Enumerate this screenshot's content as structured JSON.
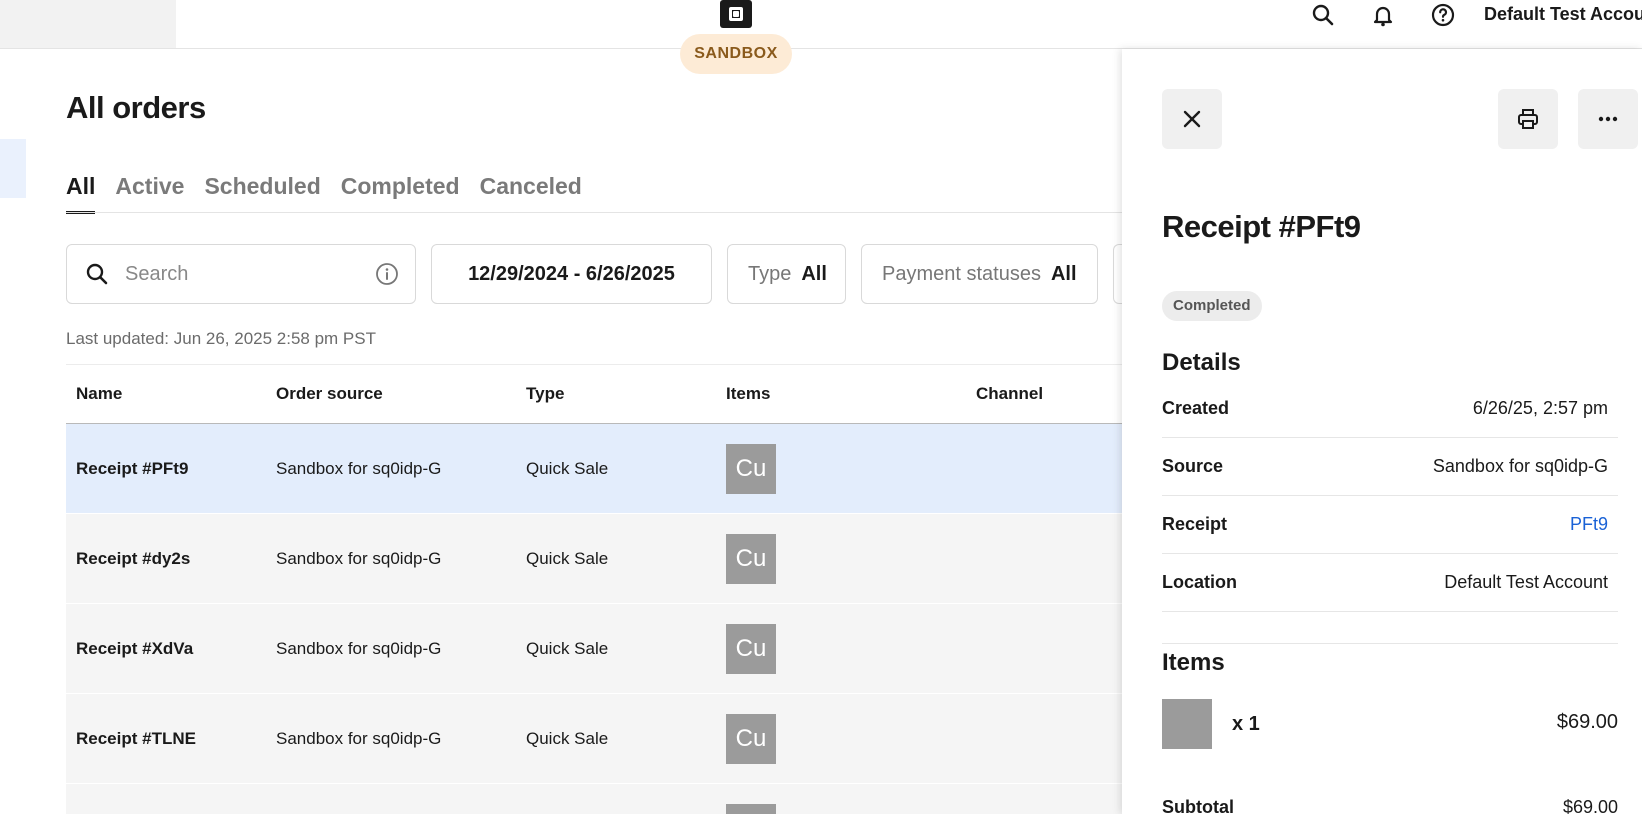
{
  "topbar": {
    "env_badge": "SANDBOX",
    "account_name": "Default Test Account"
  },
  "main": {
    "title": "All orders",
    "tabs": [
      {
        "label": "All",
        "active": true
      },
      {
        "label": "Active",
        "active": false
      },
      {
        "label": "Scheduled",
        "active": false
      },
      {
        "label": "Completed",
        "active": false
      },
      {
        "label": "Canceled",
        "active": false
      }
    ],
    "filters": {
      "search_placeholder": "Search",
      "date_range": "12/29/2024 - 6/26/2025",
      "type_label": "Type",
      "type_value": "All",
      "payment_label": "Payment statuses",
      "payment_value": "All"
    },
    "last_updated": "Last updated: Jun 26, 2025 2:58 pm PST",
    "table": {
      "columns": [
        "Name",
        "Order source",
        "Type",
        "Items",
        "Channel"
      ],
      "rows": [
        {
          "name": "Receipt #PFt9",
          "source": "Sandbox for sq0idp-G",
          "type": "Quick Sale",
          "item_thumb": "Cu",
          "channel": "",
          "selected": true
        },
        {
          "name": "Receipt #dy2s",
          "source": "Sandbox for sq0idp-G",
          "type": "Quick Sale",
          "item_thumb": "Cu",
          "channel": "",
          "selected": false
        },
        {
          "name": "Receipt #XdVa",
          "source": "Sandbox for sq0idp-G",
          "type": "Quick Sale",
          "item_thumb": "Cu",
          "channel": "",
          "selected": false
        },
        {
          "name": "Receipt #TLNE",
          "source": "Sandbox for sq0idp-G",
          "type": "Quick Sale",
          "item_thumb": "Cu",
          "channel": "",
          "selected": false
        }
      ]
    }
  },
  "panel": {
    "title": "Receipt #PFt9",
    "status": "Completed",
    "details_heading": "Details",
    "details": [
      {
        "key": "Created",
        "value": "6/26/25, 2:57 pm"
      },
      {
        "key": "Source",
        "value": "Sandbox for sq0idp-G"
      },
      {
        "key": "Receipt",
        "value": "PFt9"
      },
      {
        "key": "Location",
        "value": "Default Test Account"
      }
    ],
    "items_heading": "Items",
    "line_item": {
      "qty": "x 1",
      "price": "$69.00"
    },
    "subtotal_label": "Subtotal",
    "subtotal_value": "$69.00"
  },
  "colors": {
    "accent_link": "#1a62d6",
    "selected_row": "#e3edfc",
    "sandbox_badge_bg": "#fdebd6"
  }
}
